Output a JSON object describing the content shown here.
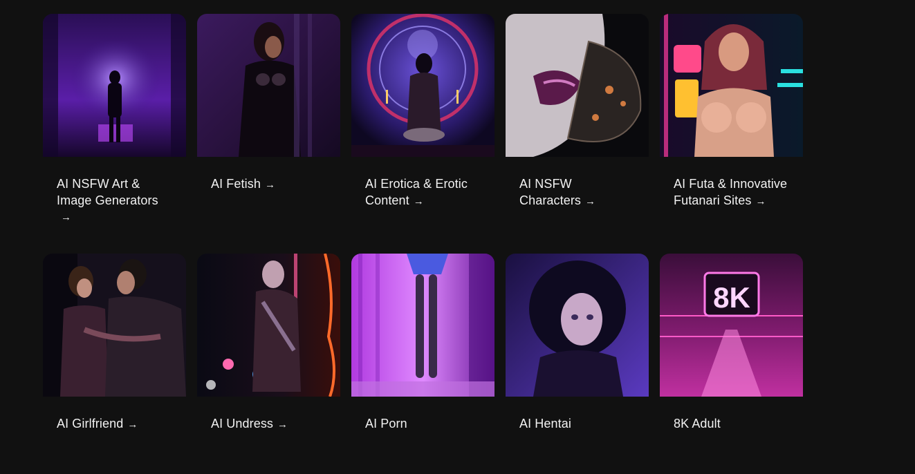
{
  "categories": [
    {
      "title": "AI NSFW Art & Image Generators",
      "arrow": "→"
    },
    {
      "title": "AI Fetish",
      "arrow": "→"
    },
    {
      "title": "AI Erotica & Erotic Content",
      "arrow": "→"
    },
    {
      "title": "AI NSFW Characters",
      "arrow": "→"
    },
    {
      "title": "AI Futa & Innovative Futanari Sites",
      "arrow": "→"
    },
    {
      "title": "AI Girlfriend",
      "arrow": "→"
    },
    {
      "title": "AI Undress",
      "arrow": "→"
    },
    {
      "title": "AI Porn",
      "arrow": ""
    },
    {
      "title": "AI Hentai",
      "arrow": ""
    },
    {
      "title": "8K Adult",
      "arrow": ""
    }
  ],
  "images": {
    "sign_text": "8K"
  }
}
